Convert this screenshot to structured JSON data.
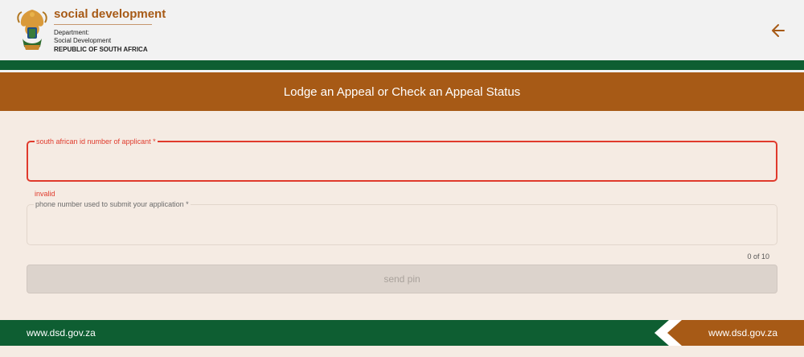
{
  "header": {
    "brand_title": "social development",
    "dept_label": "Department:",
    "dept_name": "Social Development",
    "country": "REPUBLIC OF SOUTH AFRICA",
    "back_icon": "arrow-left-icon"
  },
  "page_title": "Lodge an Appeal or Check an Appeal Status",
  "form": {
    "id_field": {
      "label": "south african id number of applicant *",
      "value": "",
      "error": "invalid"
    },
    "phone_field": {
      "label": "phone number used to submit your application *",
      "value": "",
      "counter": "0 of 10"
    },
    "send_button": "send pin"
  },
  "footer": {
    "left_url": "www.dsd.gov.za",
    "right_url": "www.dsd.gov.za"
  },
  "colors": {
    "brand_brown": "#a75a16",
    "brand_green": "#0e5e32",
    "error_red": "#e03a2c",
    "background": "#f5ebe3"
  }
}
